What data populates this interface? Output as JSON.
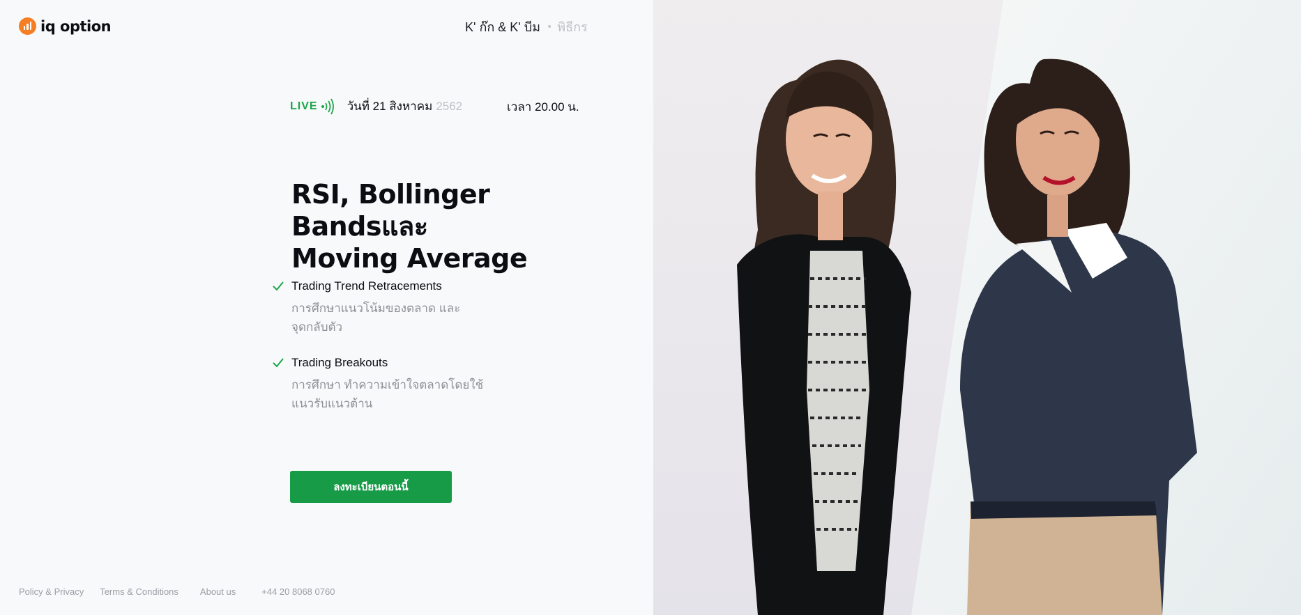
{
  "brand": {
    "name": "iq option",
    "accent": "#f57d22"
  },
  "hosts": {
    "names": "K' ก๊ก & K' บีม",
    "role": "พิธีกร"
  },
  "event": {
    "live_label": "LIVE",
    "date": "วันที่ 21 สิงหาคม",
    "year": "2562",
    "time": "เวลา 20.00 น."
  },
  "headline": {
    "line1": "RSI, Bollinger Bandsและ",
    "line2": "Moving Average"
  },
  "features": [
    {
      "title": "Trading Trend Retracements",
      "desc_line1": "การศึกษาแนวโน้มของตลาด และ",
      "desc_line2": "จุดกลับตัว"
    },
    {
      "title": "Trading Breakouts",
      "desc_line1": "การศึกษา ทำความเข้าใจตลาดโดยใช้",
      "desc_line2": "แนวรับแนวต้าน"
    }
  ],
  "cta": {
    "label": "ลงทะเบียนตอนนี้",
    "color": "#179b47"
  },
  "footer": {
    "policy": "Policy & Privacy",
    "terms": "Terms & Conditions",
    "about": "About us",
    "phone": "+44 20 8068 0760"
  },
  "icons": {
    "check": "check-icon",
    "live": "broadcast-icon"
  },
  "colors": {
    "live": "#1ba54a",
    "muted": "#8d9096"
  }
}
